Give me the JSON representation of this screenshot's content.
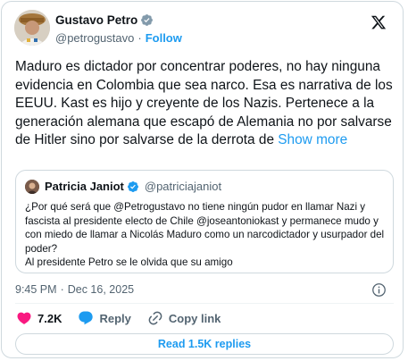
{
  "author": {
    "name": "Gustavo Petro",
    "handle": "@petrogustavo",
    "separator": "·",
    "follow_label": "Follow"
  },
  "tweet": {
    "text": "Maduro es dictador por concentrar poderes, no hay ninguna evidencia en Colombia que sea narco. Esa es narrativa de los EEUU. Kast es hijo y creyente de los Nazis. Pertenece a la generación alemana que escapó de Alemania no por salvarse de Hitler sino por salvarse de la derrota de ",
    "show_more": "Show more"
  },
  "quote": {
    "name": "Patricia Janiot",
    "handle": "@patriciajaniot",
    "text": "¿Por qué será que @Petrogustavo no tiene ningún pudor en llamar Nazi y fascista al presidente electo de Chile @joseantoniokast y permanece mudo y con miedo de llamar a Nicolás Maduro como un narcodictador y usurpador del poder?",
    "text2": "Al presidente Petro se le olvida que su amigo"
  },
  "meta": {
    "time": "9:45 PM",
    "separator": "·",
    "date": "Dec 16, 2025"
  },
  "actions": {
    "likes": "7.2K",
    "reply_label": "Reply",
    "copy_label": "Copy link"
  },
  "read_replies_label": "Read 1.5K replies",
  "colors": {
    "accent": "#1d9bf0",
    "like_red": "#f91880",
    "muted": "#536471",
    "border": "#cfd9de"
  },
  "icons": [
    "verified-badge-icon",
    "x-logo-icon",
    "info-icon",
    "heart-icon",
    "reply-icon",
    "link-icon"
  ]
}
